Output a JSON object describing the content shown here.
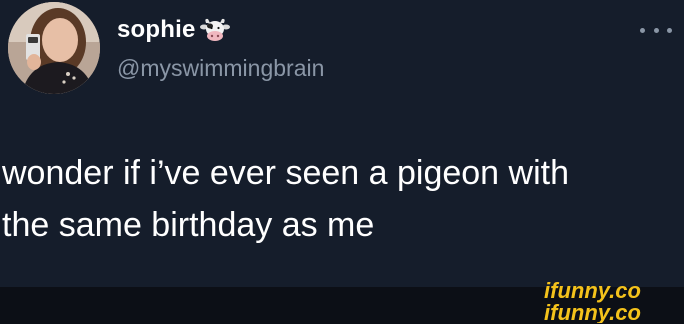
{
  "tweet": {
    "display_name": "sophie",
    "name_emoji_icon": "cow-face-icon",
    "handle": "@myswimmingbrain",
    "text_line1": "wonder if i’ve ever seen a pigeon with",
    "text_line2": "the same birthday as me",
    "more_icon": "more-options-icon"
  },
  "watermark": {
    "text": "ifunny.co",
    "color": "#f4c21b"
  },
  "colors": {
    "background": "#151d2b",
    "secondary_text": "#8a96a6",
    "bottom_bar": "#0c0f16"
  }
}
